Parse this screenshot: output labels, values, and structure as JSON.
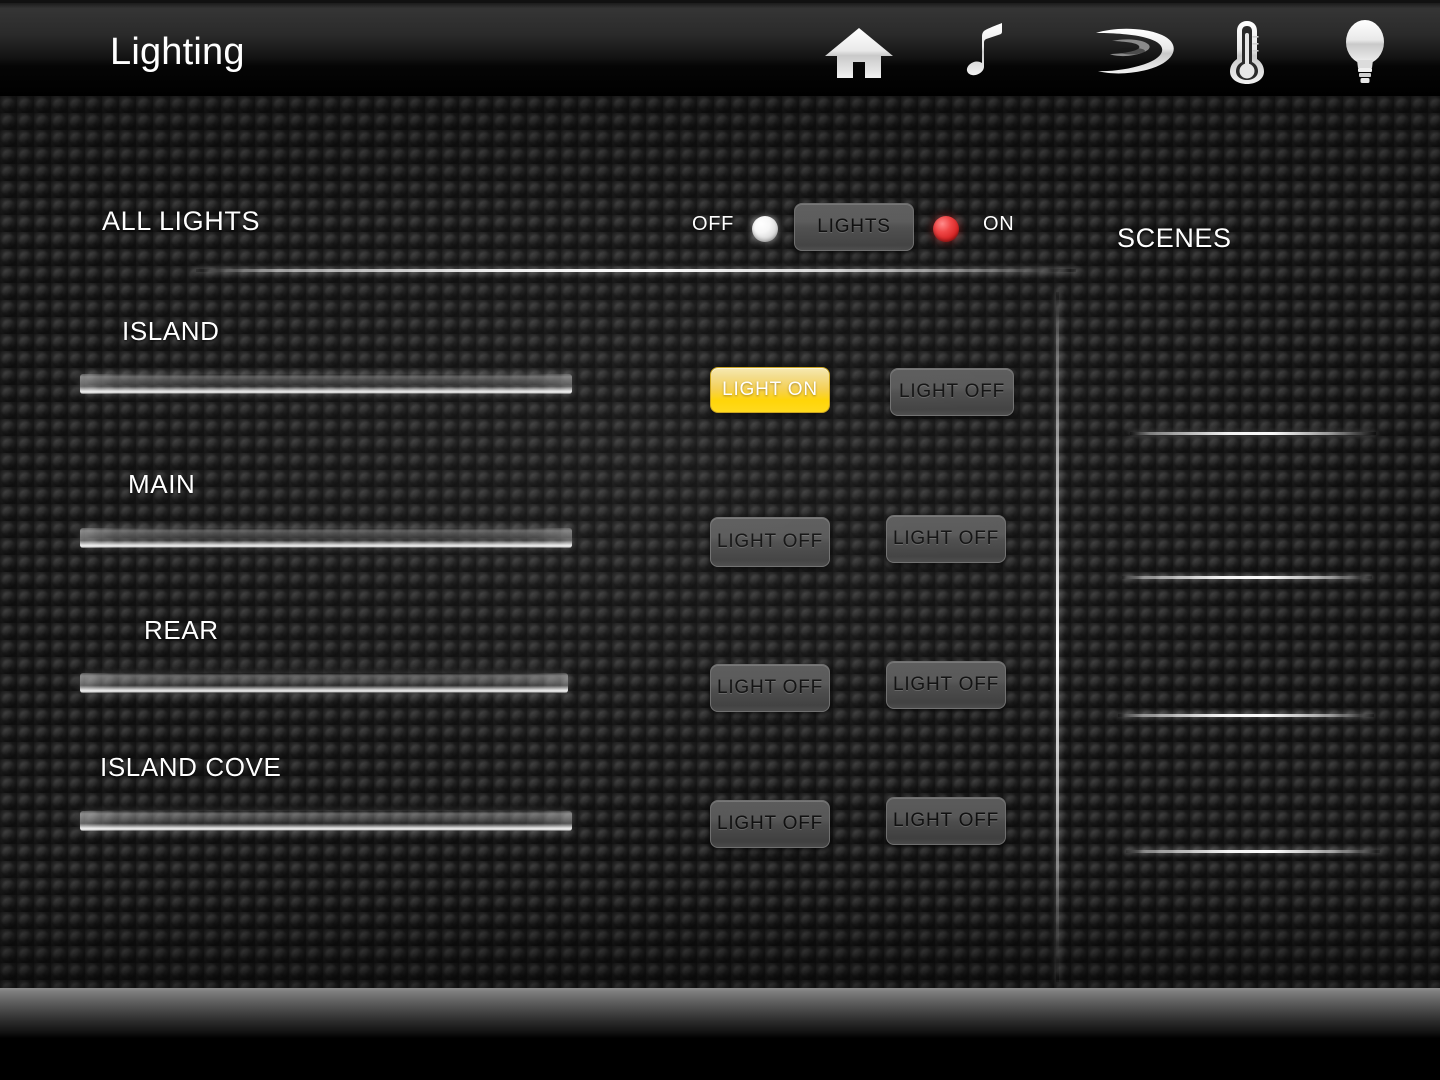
{
  "header": {
    "title": "Lighting",
    "nav_icons": [
      {
        "name": "home-icon",
        "label": "Home"
      },
      {
        "name": "music-note-icon",
        "label": "Music"
      },
      {
        "name": "bluray-icon",
        "label": "Blu-ray"
      },
      {
        "name": "thermometer-icon",
        "label": "Climate"
      },
      {
        "name": "lightbulb-icon",
        "label": "Lighting"
      }
    ]
  },
  "main": {
    "all_lights_label": "ALL LIGHTS",
    "scenes_label": "SCENES",
    "master_toggle": {
      "off_label": "OFF",
      "on_label": "ON",
      "button_label": "LIGHTS",
      "off_led_color": "#ffffff",
      "on_led_color": "#d41f1f"
    },
    "zones": [
      {
        "name": "ISLAND",
        "slider_level": 100,
        "buttons": [
          {
            "label": "LIGHT ON",
            "state": "on"
          },
          {
            "label": "LIGHT OFF",
            "state": "off"
          }
        ]
      },
      {
        "name": "MAIN",
        "slider_level": 100,
        "buttons": [
          {
            "label": "LIGHT OFF",
            "state": "off"
          },
          {
            "label": "LIGHT OFF",
            "state": "off"
          }
        ]
      },
      {
        "name": "REAR",
        "slider_level": 100,
        "buttons": [
          {
            "label": "LIGHT OFF",
            "state": "off"
          },
          {
            "label": "LIGHT OFF",
            "state": "off"
          }
        ]
      },
      {
        "name": "ISLAND COVE",
        "slider_level": 100,
        "buttons": [
          {
            "label": "LIGHT OFF",
            "state": "off"
          },
          {
            "label": "LIGHT OFF",
            "state": "off"
          }
        ]
      }
    ],
    "scene_slots": [
      {
        "label": ""
      },
      {
        "label": ""
      },
      {
        "label": ""
      },
      {
        "label": ""
      }
    ]
  },
  "theme": {
    "accent_on": "#ffd400",
    "led_red": "#d41f1f",
    "led_white": "#ffffff",
    "text": "#ffffff",
    "surface": "#232323"
  }
}
